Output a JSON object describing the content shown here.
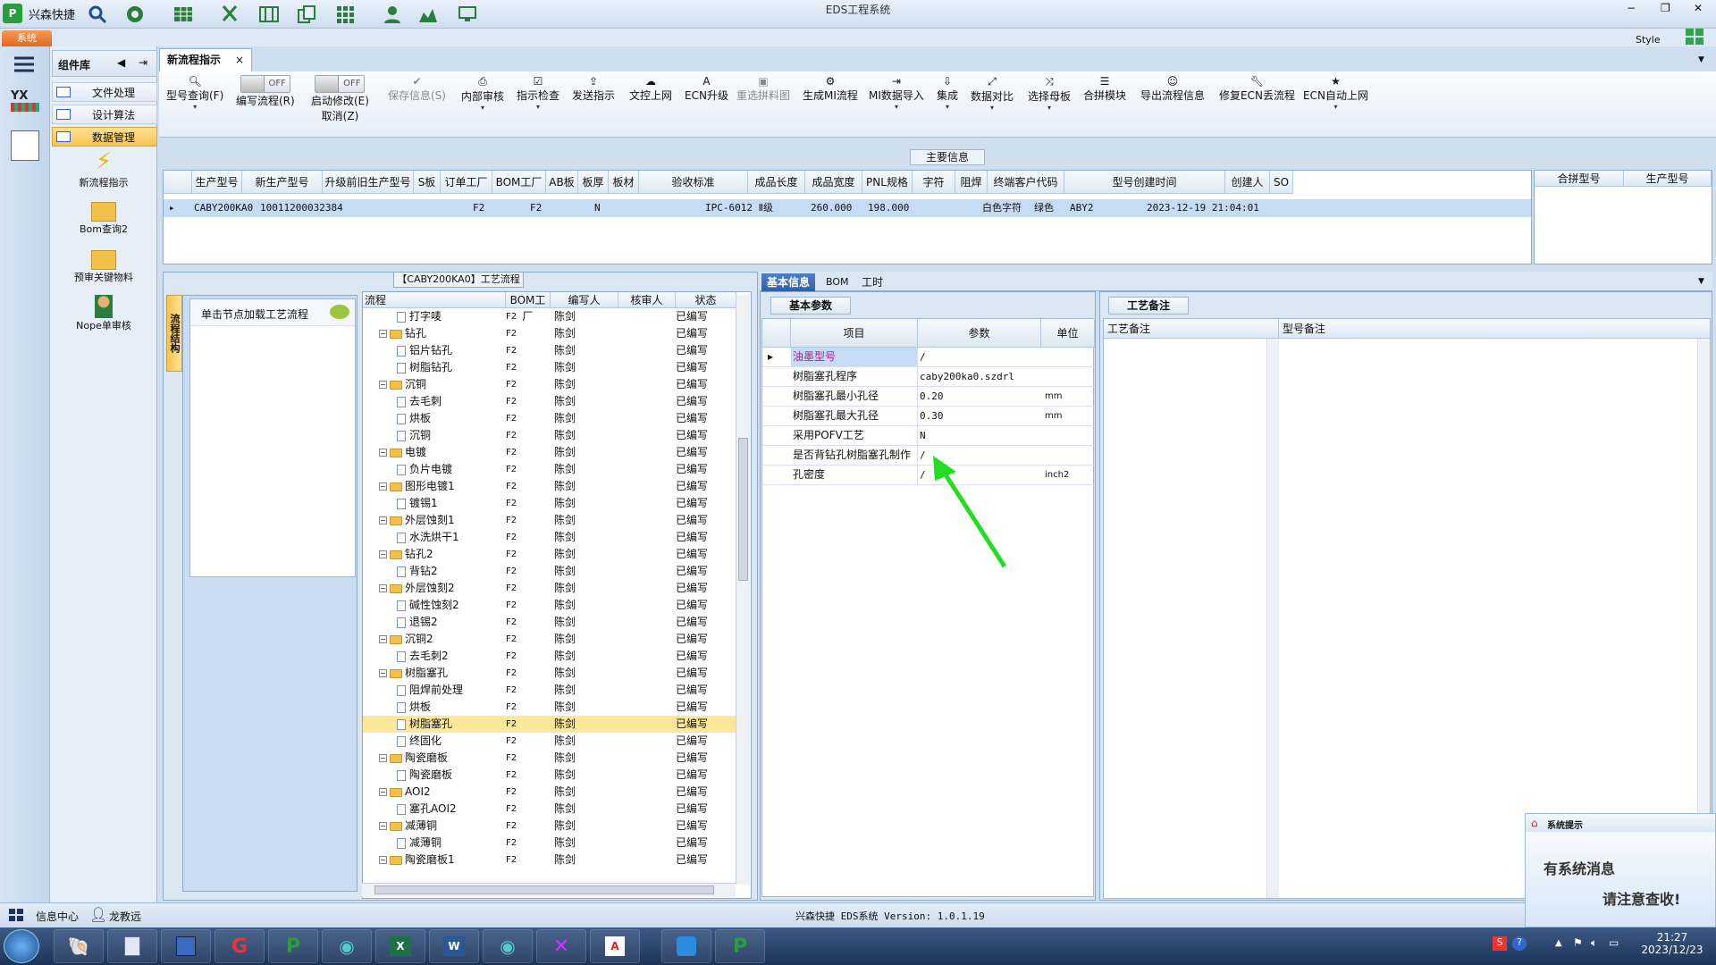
{
  "app": {
    "name": "兴森快捷",
    "title": "EDS工程系统",
    "style_label": "Style",
    "ribbon_tab": "系统"
  },
  "sidebar": {
    "header": "组件库",
    "items": [
      {
        "label": "文件处理"
      },
      {
        "label": "设计算法"
      },
      {
        "label": "数据管理",
        "selected": true
      }
    ],
    "buttons": [
      "新流程指示",
      "Bom查询2",
      "预审关键物料",
      "Nope单审核"
    ]
  },
  "doc_tab": {
    "label": "新流程指示"
  },
  "toolbar": {
    "buttons": [
      "型号查询(F)",
      "编写流程(R)",
      "启动修改(E)",
      "保存信息(S)",
      "内部审核",
      "指示检查",
      "发送指示",
      "文控上网",
      "ECN升级",
      "重选拼料图",
      "生成MI流程",
      "MI数据导入",
      "集成",
      "数据对比",
      "选择母板",
      "合拼模块",
      "导出流程信息",
      "修复ECN丢流程",
      "ECN自动上网"
    ],
    "toggle_label": "OFF",
    "cancel_label": "取消(Z)"
  },
  "main_info": {
    "label": "主要信息",
    "columns": [
      "生产型号",
      "新生产型号",
      "升级前旧生产型号",
      "S板",
      "订单工厂",
      "BOM工厂",
      "AB板",
      "板厚",
      "板材",
      "验收标准",
      "成品长度",
      "成品宽度",
      "PNL规格",
      "字符",
      "阻焊",
      "终端客户代码",
      "型号创建时间",
      "创建人",
      "SO"
    ],
    "row": {
      "model": "CABY200KA0",
      "new_model": "10011200032384",
      "order_factory": "F2",
      "bom_factory": "F2",
      "ab": "N",
      "standard": "IPC-6012 Ⅱ级",
      "length": "260.000",
      "width": "198.000",
      "char": "白色字符",
      "mask": "绿色",
      "customer": "ABY2",
      "created": "2023-12-19 21:04:01"
    },
    "side_columns": [
      "合拼型号",
      "生产型号"
    ]
  },
  "process": {
    "title": "【CABY200KA0】工艺流程",
    "struct_tab": "流程结构",
    "hint": "单击节点加载工艺流程",
    "columns": [
      "流程",
      "BOM工厂",
      "编写人",
      "核审人",
      "状态"
    ],
    "rows": [
      {
        "name": "打字唛",
        "level": 2,
        "factory": "F2",
        "writer": "陈剑",
        "status": "已编写"
      },
      {
        "name": "钻孔",
        "level": 1,
        "factory": "F2",
        "writer": "陈剑",
        "status": "已编写"
      },
      {
        "name": "铝片钻孔",
        "level": 2,
        "factory": "F2",
        "writer": "陈剑",
        "status": "已编写"
      },
      {
        "name": "树脂钻孔",
        "level": 2,
        "factory": "F2",
        "writer": "陈剑",
        "status": "已编写"
      },
      {
        "name": "沉铜",
        "level": 1,
        "factory": "F2",
        "writer": "陈剑",
        "status": "已编写"
      },
      {
        "name": "去毛刺",
        "level": 2,
        "factory": "F2",
        "writer": "陈剑",
        "status": "已编写"
      },
      {
        "name": "烘板",
        "level": 2,
        "factory": "F2",
        "writer": "陈剑",
        "status": "已编写"
      },
      {
        "name": "沉铜",
        "level": 2,
        "factory": "F2",
        "writer": "陈剑",
        "status": "已编写"
      },
      {
        "name": "电镀",
        "level": 1,
        "factory": "F2",
        "writer": "陈剑",
        "status": "已编写"
      },
      {
        "name": "负片电镀",
        "level": 2,
        "factory": "F2",
        "writer": "陈剑",
        "status": "已编写"
      },
      {
        "name": "图形电镀1",
        "level": 1,
        "factory": "F2",
        "writer": "陈剑",
        "status": "已编写"
      },
      {
        "name": "镀锡1",
        "level": 2,
        "factory": "F2",
        "writer": "陈剑",
        "status": "已编写"
      },
      {
        "name": "外层蚀刻1",
        "level": 1,
        "factory": "F2",
        "writer": "陈剑",
        "status": "已编写"
      },
      {
        "name": "水洗烘干1",
        "level": 2,
        "factory": "F2",
        "writer": "陈剑",
        "status": "已编写"
      },
      {
        "name": "钻孔2",
        "level": 1,
        "factory": "F2",
        "writer": "陈剑",
        "status": "已编写"
      },
      {
        "name": "背钻2",
        "level": 2,
        "factory": "F2",
        "writer": "陈剑",
        "status": "已编写"
      },
      {
        "name": "外层蚀刻2",
        "level": 1,
        "factory": "F2",
        "writer": "陈剑",
        "status": "已编写"
      },
      {
        "name": "碱性蚀刻2",
        "level": 2,
        "factory": "F2",
        "writer": "陈剑",
        "status": "已编写"
      },
      {
        "name": "退锡2",
        "level": 2,
        "factory": "F2",
        "writer": "陈剑",
        "status": "已编写"
      },
      {
        "name": "沉铜2",
        "level": 1,
        "factory": "F2",
        "writer": "陈剑",
        "status": "已编写"
      },
      {
        "name": "去毛刺2",
        "level": 2,
        "factory": "F2",
        "writer": "陈剑",
        "status": "已编写"
      },
      {
        "name": "树脂塞孔",
        "level": 1,
        "factory": "F2",
        "writer": "陈剑",
        "status": "已编写"
      },
      {
        "name": "阻焊前处理",
        "level": 2,
        "factory": "F2",
        "writer": "陈剑",
        "status": "已编写"
      },
      {
        "name": "烘板",
        "level": 2,
        "factory": "F2",
        "writer": "陈剑",
        "status": "已编写"
      },
      {
        "name": "树脂塞孔",
        "level": 2,
        "factory": "F2",
        "writer": "陈剑",
        "status": "已编写",
        "selected": true
      },
      {
        "name": "终固化",
        "level": 2,
        "factory": "F2",
        "writer": "陈剑",
        "status": "已编写"
      },
      {
        "name": "陶瓷磨板",
        "level": 1,
        "factory": "F2",
        "writer": "陈剑",
        "status": "已编写"
      },
      {
        "name": "陶瓷磨板",
        "level": 2,
        "factory": "F2",
        "writer": "陈剑",
        "status": "已编写"
      },
      {
        "name": "AOI2",
        "level": 1,
        "factory": "F2",
        "writer": "陈剑",
        "status": "已编写"
      },
      {
        "name": "塞孔AOI2",
        "level": 2,
        "factory": "F2",
        "writer": "陈剑",
        "status": "已编写"
      },
      {
        "name": "减薄铜",
        "level": 1,
        "factory": "F2",
        "writer": "陈剑",
        "status": "已编写"
      },
      {
        "name": "减薄铜",
        "level": 2,
        "factory": "F2",
        "writer": "陈剑",
        "status": "已编写"
      },
      {
        "name": "陶瓷磨板1",
        "level": 1,
        "factory": "F2",
        "writer": "陈剑",
        "status": "已编写"
      }
    ]
  },
  "info_tabs": [
    "基本信息",
    "BOM",
    "工时"
  ],
  "basic": {
    "title": "基本参数",
    "columns": [
      "项目",
      "参数",
      "单位"
    ],
    "rows": [
      {
        "item": "油墨型号",
        "value": "/",
        "unit": ""
      },
      {
        "item": "树脂塞孔程序",
        "value": "caby200ka0.szdrl",
        "unit": ""
      },
      {
        "item": "树脂塞孔最小孔径",
        "value": "0.20",
        "unit": "mm"
      },
      {
        "item": "树脂塞孔最大孔径",
        "value": "0.30",
        "unit": "mm"
      },
      {
        "item": "采用POFV工艺",
        "value": "N",
        "unit": ""
      },
      {
        "item": "是否背钻孔树脂塞孔制作",
        "value": "/",
        "unit": ""
      },
      {
        "item": "孔密度",
        "value": "/",
        "unit": "inch2"
      }
    ]
  },
  "notes": {
    "tab": "工艺备注",
    "col1": "工艺备注",
    "col2": "型号备注"
  },
  "status": {
    "info_center": "信息中心",
    "user": "龙教远",
    "version": "兴森快捷 EDS系统 Version: 1.0.1.19"
  },
  "popup": {
    "title": "系统提示",
    "line1": "有系统消息",
    "line2": "请注意查收!"
  },
  "clock": {
    "time": "21:27",
    "date": "2023/12/23"
  },
  "colors": {
    "accent": "#2e5fa8",
    "selected": "#fde79a",
    "arrow": "#22dd22"
  }
}
